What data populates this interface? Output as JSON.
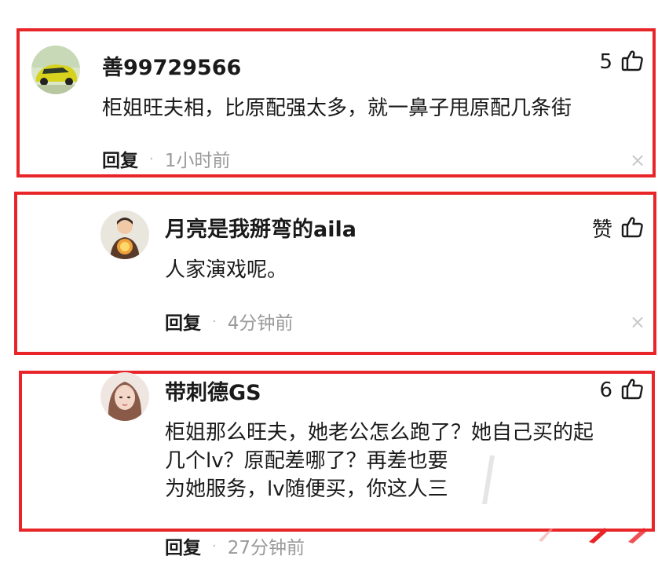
{
  "comments": [
    {
      "username": "善99729566",
      "likes": "5",
      "lines": [
        "柜姐旺夫相，比原配强太多，就一鼻子甩原配几条街"
      ],
      "reply_label": "回复",
      "dot": "·",
      "time": "1小时前",
      "close": "×"
    },
    {
      "username": "月亮是我掰弯的aila",
      "likes": "赞",
      "lines": [
        "人家演戏呢。"
      ],
      "reply_label": "回复",
      "dot": "·",
      "time": "4分钟前",
      "close": "×"
    },
    {
      "username": "带刺德GS",
      "likes": "6",
      "lines": [
        "柜姐那么旺夫，她老公怎么跑了？她自己买的起",
        "几个lv？原配差哪了？再差也要",
        "为她服务，lv随便买，你这人三"
      ],
      "reply_label": "回复",
      "dot": "·",
      "time": "27分钟前"
    }
  ],
  "colors": {
    "highlight": "#e8262a",
    "meta": "#9a9a9a"
  },
  "icons": [
    "thumbs-up-icon",
    "close-icon",
    "avatar-image"
  ]
}
